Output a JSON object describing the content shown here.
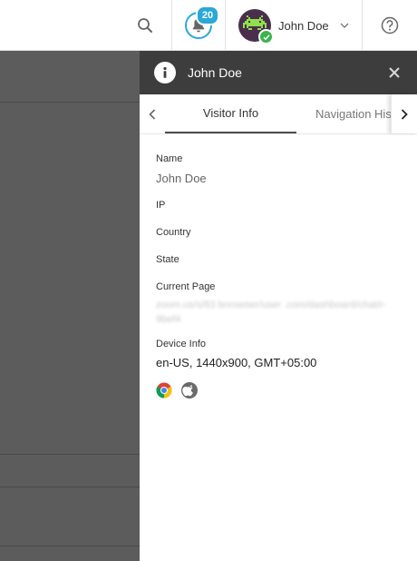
{
  "topbar": {
    "notifications": {
      "count": "20"
    },
    "user": {
      "name": "John Doe",
      "status": "online"
    },
    "icons": {
      "search": "search-icon",
      "bell": "bell-icon",
      "help": "help-icon",
      "chevron": "chevron-down-icon"
    }
  },
  "panel": {
    "title": "John Doe",
    "tabs": [
      {
        "label": "Visitor Info",
        "active": true
      },
      {
        "label": "Navigation History",
        "active": false
      }
    ],
    "fields": {
      "name_label": "Name",
      "name_value": "John Doe",
      "ip_label": "IP",
      "country_label": "Country",
      "state_label": "State",
      "current_page_label": "Current Page",
      "current_page_value": "zoom.us/s/83 bnrowser/user .com/dashboard/chat/r- 9bef4",
      "device_info_label": "Device Info",
      "device_info_value": "en-US, 1440x900, GMT+05:00"
    },
    "browser_icons": [
      "chrome-icon",
      "apple-icon"
    ]
  },
  "colors": {
    "accent": "#2aa9d8",
    "header_bg": "#3d3d3d",
    "backdrop": "#5c5c5c",
    "online": "#3cb44b",
    "avatar_bg": "#4a2f4d",
    "avatar_fg": "#8fe04a"
  }
}
